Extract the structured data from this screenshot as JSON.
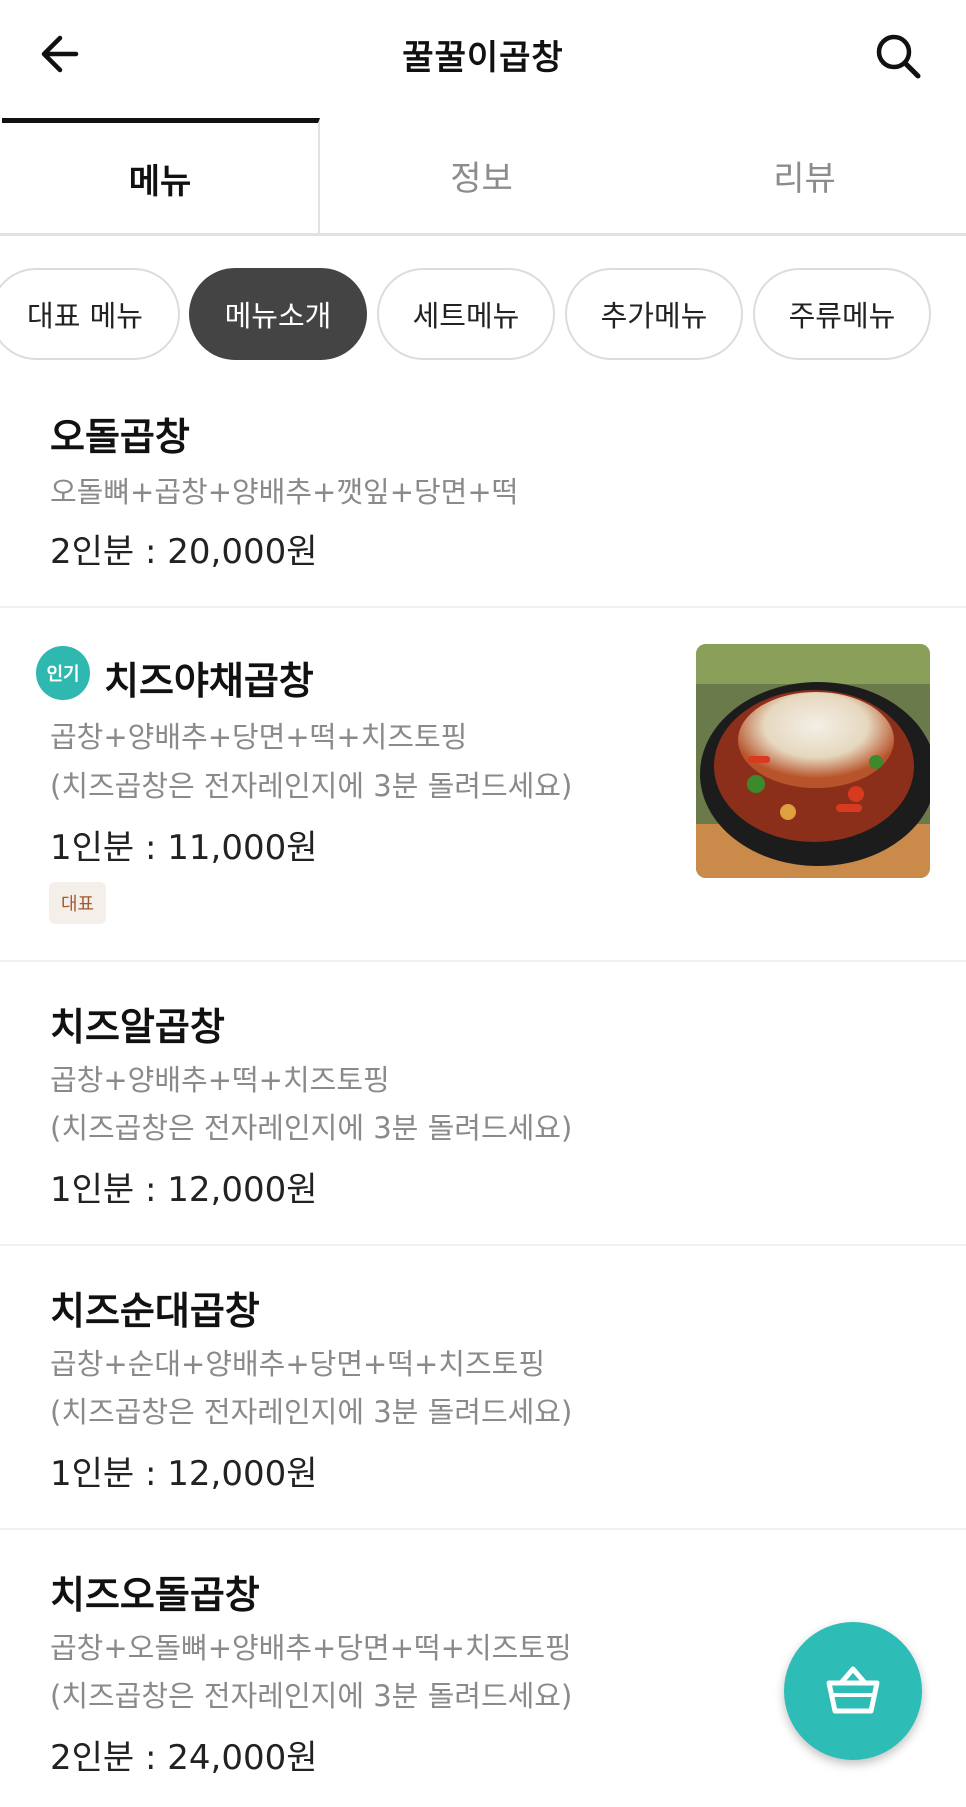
{
  "header": {
    "title": "꿀꿀이곱창",
    "back_icon": "arrow-left-icon",
    "search_icon": "search-icon"
  },
  "tabs": [
    {
      "label": "메뉴",
      "active": true
    },
    {
      "label": "정보",
      "active": false
    },
    {
      "label": "리뷰",
      "active": false
    }
  ],
  "categories": [
    {
      "label": "대표 메뉴",
      "active": false
    },
    {
      "label": "메뉴소개",
      "active": true
    },
    {
      "label": "세트메뉴",
      "active": false
    },
    {
      "label": "추가메뉴",
      "active": false
    },
    {
      "label": "주류메뉴",
      "active": false
    }
  ],
  "menu_items": [
    {
      "name": "오돌곱창",
      "desc1": "오돌뼈+곱창+양배추+깻잎+당면+떡",
      "price": "2인분 : 20,000원"
    },
    {
      "name": "치즈야채곱창",
      "badge": "인기",
      "desc1": "곱창+양배추+당면+떡+치즈토핑",
      "desc2": "(치즈곱창은 전자레인지에 3분 돌려드세요)",
      "price": "1인분 : 11,000원",
      "tag": "대표"
    },
    {
      "name": "치즈알곱창",
      "desc1": "곱창+양배추+떡+치즈토핑",
      "desc2": "(치즈곱창은 전자레인지에 3분 돌려드세요)",
      "price": "1인분 : 12,000원"
    },
    {
      "name": "치즈순대곱창",
      "desc1": "곱창+순대+양배추+당면+떡+치즈토핑",
      "desc2": "(치즈곱창은 전자레인지에 3분 돌려드세요)",
      "price": "1인분 : 12,000원"
    },
    {
      "name": "치즈오돌곱창",
      "desc1": "곱창+오돌뼈+양배추+당면+떡+치즈토핑",
      "desc2": "(치즈곱창은 전자레인지에 3분 돌려드세요)",
      "price": "2인분 : 24,000원"
    }
  ],
  "colors": {
    "accent": "#2dbcb6",
    "active_chip": "#444444",
    "tag_text": "#a25a34"
  },
  "fab": {
    "icon": "basket-icon"
  }
}
